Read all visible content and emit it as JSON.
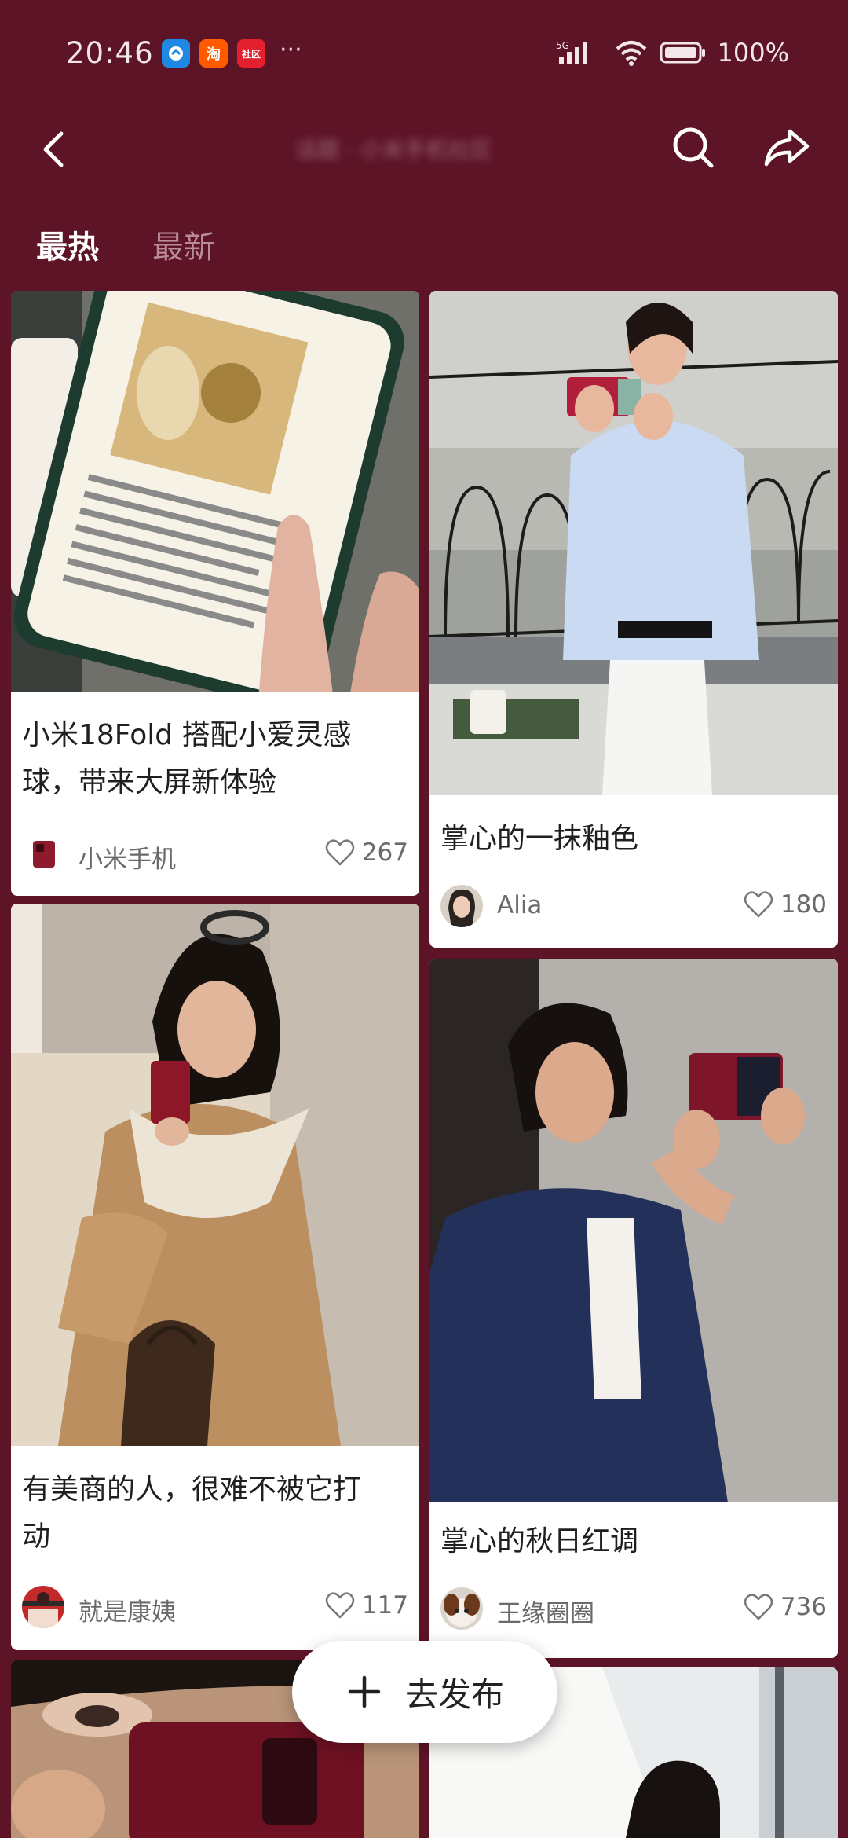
{
  "status": {
    "time": "20:46",
    "apps": [
      {
        "name": "bluebird-app-icon",
        "color": "#1e88e5",
        "glyph": "✈"
      },
      {
        "name": "taobao-app-icon",
        "color": "#ff5a00",
        "glyph": "淘"
      },
      {
        "name": "xianyu-app-icon",
        "color": "#e5202e",
        "glyph": "社区"
      }
    ],
    "more": "···",
    "signal": "5G",
    "battery": "100%"
  },
  "header": {
    "title": "话题 · 小米手机社区"
  },
  "tabs": [
    {
      "label": "最热",
      "active": true
    },
    {
      "label": "最新",
      "active": false
    }
  ],
  "posts": [
    {
      "title_line1": "小米18Fold 搭配小爱灵感",
      "title_line2": "球，带来大屏新体验",
      "author": "小米手机",
      "likes": "267"
    },
    {
      "title_line1": "掌心的一抹釉色",
      "author": "Alia",
      "likes": "180"
    },
    {
      "title_line1": "有美商的人，很难不被它打",
      "title_line2": "动",
      "author": "就是康姨",
      "likes": "117"
    },
    {
      "title_line1": "掌心的秋日红调",
      "author": "王缘圈圈",
      "likes": "736"
    }
  ],
  "fab": {
    "label": "去发布"
  },
  "colors": {
    "background": "#5e1427",
    "card": "#ffffff",
    "muted_tab": "#b98d98"
  }
}
